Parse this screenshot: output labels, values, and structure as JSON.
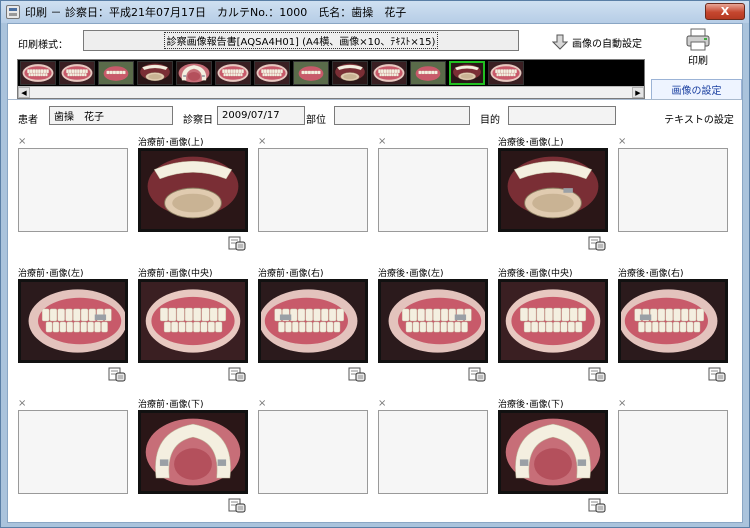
{
  "window": {
    "title": "印刷 － 診察日：平成21年07月17日　カルテNo.：1000　氏名：歯操　花子",
    "close_label": "X"
  },
  "toolbar": {
    "print_style_label": "印刷様式：",
    "print_style_value": "診察画像報告書[AQSA4H01] (A4横、画像×10、ﾃｷｽﾄ×15)",
    "auto_set_label": "画像の自動設定",
    "print_label": "印刷"
  },
  "thumbnail_strip": {
    "thumb_count": 13,
    "selected_index": 11,
    "thumb_kinds": [
      "front",
      "front",
      "side",
      "upper",
      "lower",
      "front",
      "front",
      "side",
      "upper",
      "front",
      "side",
      "upper",
      "front"
    ]
  },
  "tabs": {
    "image_settings": "画像の設定",
    "text_settings": "テキストの設定"
  },
  "patient": {
    "patient_label": "患者",
    "patient_name": "歯操　花子",
    "exam_date_label": "診察日",
    "exam_date": "2009/07/17",
    "part_label": "部位",
    "part_value": "",
    "purpose_label": "目的",
    "purpose_value": ""
  },
  "grid": {
    "empty_mark": "×",
    "rows": [
      [
        {
          "label": "",
          "filled": false
        },
        {
          "label": "治療前･画像(上)",
          "filled": true,
          "kind": "upper"
        },
        {
          "label": "",
          "filled": false
        },
        {
          "label": "",
          "filled": false
        },
        {
          "label": "治療後･画像(上)",
          "filled": true,
          "kind": "upper2"
        },
        {
          "label": "",
          "filled": false
        }
      ],
      [
        {
          "label": "治療前･画像(左)",
          "filled": true,
          "kind": "left"
        },
        {
          "label": "治療前･画像(中央)",
          "filled": true,
          "kind": "front"
        },
        {
          "label": "治療前･画像(右)",
          "filled": true,
          "kind": "right"
        },
        {
          "label": "治療後･画像(左)",
          "filled": true,
          "kind": "left"
        },
        {
          "label": "治療後･画像(中央)",
          "filled": true,
          "kind": "front"
        },
        {
          "label": "治療後･画像(右)",
          "filled": true,
          "kind": "right"
        }
      ],
      [
        {
          "label": "",
          "filled": false
        },
        {
          "label": "治療前･画像(下)",
          "filled": true,
          "kind": "lower"
        },
        {
          "label": "",
          "filled": false
        },
        {
          "label": "",
          "filled": false
        },
        {
          "label": "治療後･画像(下)",
          "filled": true,
          "kind": "lower"
        },
        {
          "label": "",
          "filled": false
        }
      ]
    ]
  },
  "colors": {
    "selection": "#21c021",
    "gum": "#c85a6a",
    "tooth": "#f4efe0"
  }
}
